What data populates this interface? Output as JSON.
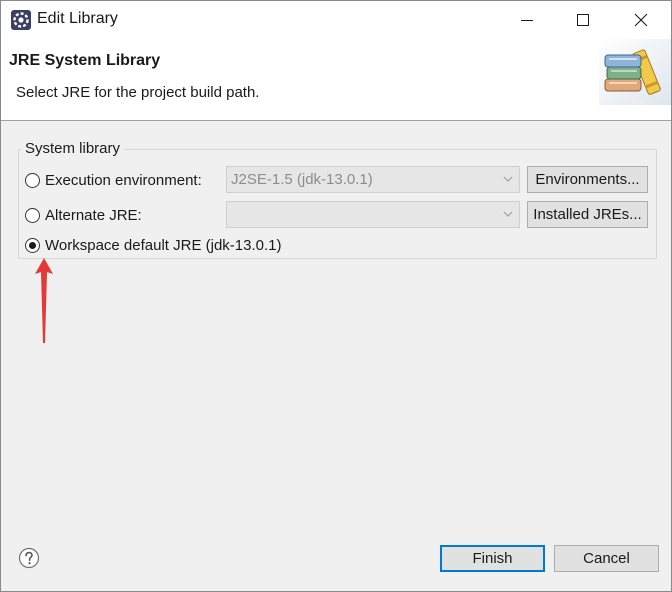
{
  "window": {
    "title": "Edit Library",
    "app_icon": "eclipse-gear-icon",
    "controls": {
      "minimize": "minimize-icon",
      "maximize": "maximize-icon",
      "close": "close-icon"
    }
  },
  "banner": {
    "title": "JRE System Library",
    "description": "Select JRE for the project build path.",
    "image": "library-books-icon"
  },
  "group": {
    "legend": "System library",
    "options": [
      {
        "label": "Execution environment:",
        "checked": false,
        "combo_value": "J2SE-1.5 (jdk-13.0.1)",
        "button": "Environments..."
      },
      {
        "label": "Alternate JRE:",
        "checked": false,
        "combo_value": "",
        "button": "Installed JREs..."
      },
      {
        "label": "Workspace default JRE (jdk-13.0.1)",
        "checked": true
      }
    ]
  },
  "annotation": {
    "color": "#e53935",
    "icon": "red-arrow-up-icon"
  },
  "footer": {
    "help_icon": "help-icon",
    "finish": "Finish",
    "cancel": "Cancel"
  },
  "colors": {
    "default_button_border": "#0078d7",
    "banner_bg": "#ffffff",
    "dialog_bg": "#f0f0f0"
  }
}
